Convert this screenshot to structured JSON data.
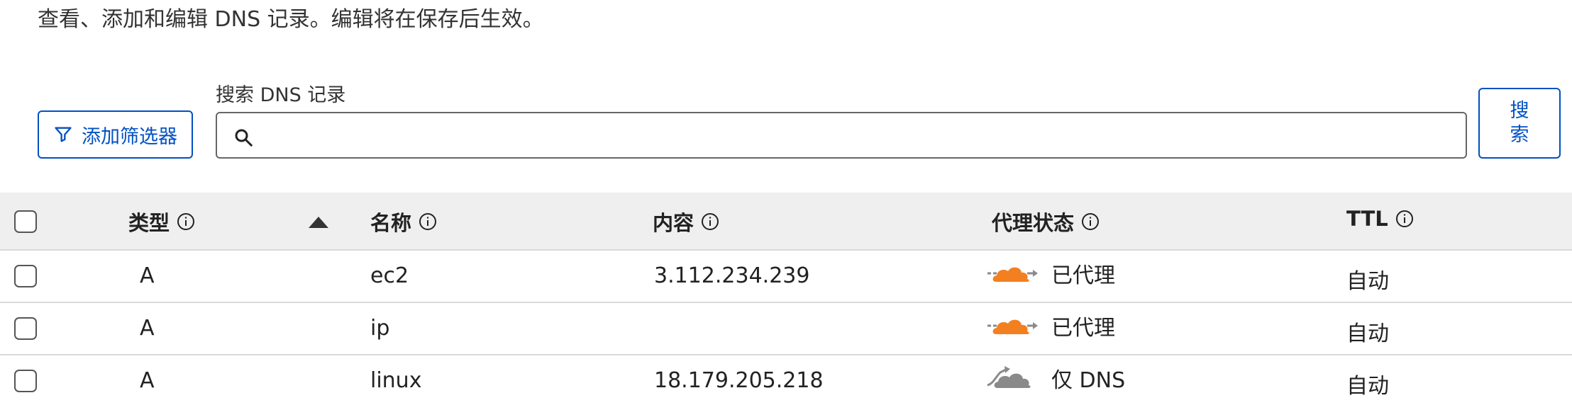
{
  "description": "查看、添加和编辑 DNS 记录。编辑将在保存后生效。",
  "filter_button": {
    "label": "添加筛选器",
    "icon": "filter-icon"
  },
  "search": {
    "label": "搜索 DNS 记录",
    "placeholder": "",
    "value": "",
    "icon": "search-icon"
  },
  "search_button": {
    "label": "搜索"
  },
  "table": {
    "columns": [
      {
        "label": "类型",
        "info_icon": "info-icon",
        "sorted": "ascending"
      },
      {
        "label": "名称",
        "info_icon": "info-icon"
      },
      {
        "label": "内容",
        "info_icon": "info-icon"
      },
      {
        "label": "代理状态",
        "info_icon": "info-icon"
      },
      {
        "label": "TTL",
        "info_icon": "info-icon"
      }
    ],
    "rows": [
      {
        "type": "A",
        "name": "ec2",
        "content": "3.112.234.239",
        "proxy_status": "已代理",
        "proxy_icon": "orange-cloud-icon",
        "ttl": "自动"
      },
      {
        "type": "A",
        "name": "ip",
        "content": "",
        "proxy_status": "已代理",
        "proxy_icon": "orange-cloud-icon",
        "ttl": "自动"
      },
      {
        "type": "A",
        "name": "linux",
        "content": "18.179.205.218",
        "proxy_status": "仅 DNS",
        "proxy_icon": "gray-cloud-icon",
        "ttl": "自动"
      }
    ]
  },
  "colors": {
    "accent": "#0051c3",
    "proxied_cloud": "#f38020",
    "dns_only_cloud": "#8a8a8a",
    "header_bg": "#efefef"
  }
}
